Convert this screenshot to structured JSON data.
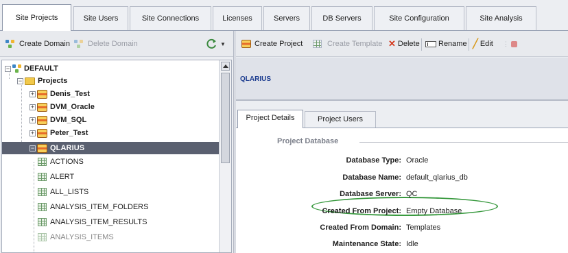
{
  "top_tabs": [
    "Site Projects",
    "Site Users",
    "Site Connections",
    "Licenses",
    "Servers",
    "DB Servers",
    "Site Configuration",
    "Site Analysis"
  ],
  "left_toolbar": {
    "create_domain": "Create Domain",
    "delete_domain": "Delete Domain"
  },
  "tree": {
    "root": "DEFAULT",
    "projects_folder": "Projects",
    "projects": [
      "Denis_Test",
      "DVM_Oracle",
      "DVM_SQL",
      "Peter_Test",
      "QLARIUS"
    ],
    "tables": [
      "ACTIONS",
      "ALERT",
      "ALL_LISTS",
      "ANALYSIS_ITEM_FOLDERS",
      "ANALYSIS_ITEM_RESULTS",
      "ANALYSIS_ITEMS"
    ]
  },
  "right_toolbar": {
    "create_project": "Create Project",
    "create_template": "Create Template",
    "delete": "Delete",
    "rename": "Rename",
    "edit": "Edit"
  },
  "entity_title": "QLARIUS",
  "sub_tabs": [
    "Project Details",
    "Project Users"
  ],
  "section_title": "Project Database",
  "fields": [
    {
      "label": "Database Type:",
      "value": "Oracle"
    },
    {
      "label": "Database Name:",
      "value": "default_qlarius_db"
    },
    {
      "label": "Database Server:",
      "value": "QC"
    },
    {
      "label": "Created From Project:",
      "value": "Empty Database"
    },
    {
      "label": "Created From Domain:",
      "value": "Templates"
    },
    {
      "label": "Maintenance State:",
      "value": "Idle"
    }
  ],
  "colors": {
    "selection": "#5a6070",
    "title_text": "#1b3b8f",
    "highlight_ellipse": "#3a9a40",
    "delete_x": "#d43a1f"
  }
}
